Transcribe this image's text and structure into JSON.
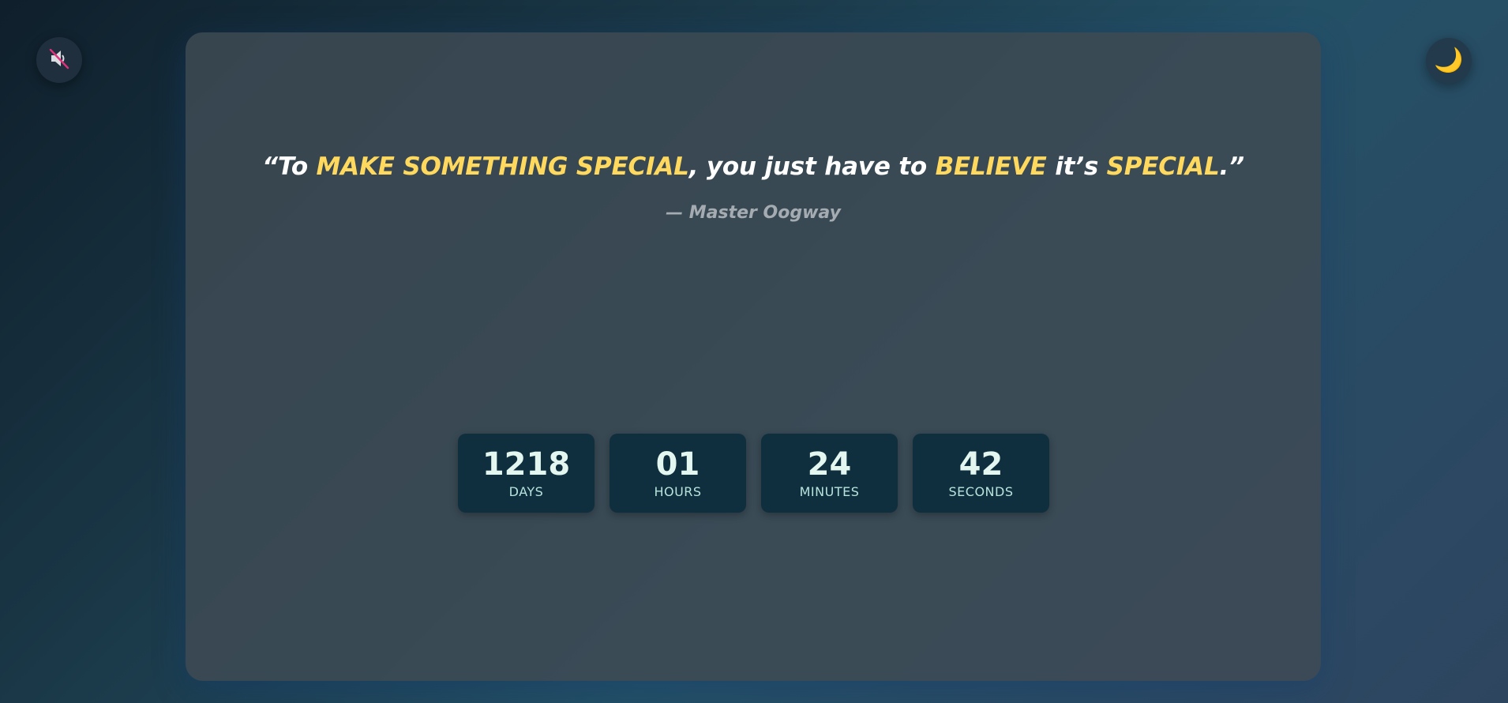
{
  "controls": {
    "mute_icon": "speaker-muted-icon",
    "theme_icon": "moon-icon",
    "theme_glyph": "🌙"
  },
  "quote": {
    "open": "“To ",
    "hl1": "MAKE SOMETHING SPECIAL",
    "mid1": ", you just have to ",
    "hl2": "BELIEVE",
    "mid2": " it’s ",
    "hl3": "SPECIAL",
    "close": ".”",
    "author": "— Master Oogway"
  },
  "countdown": {
    "days": "1218",
    "days_label": "DAYS",
    "hours": "01",
    "hours_label": "HOURS",
    "minutes": "24",
    "minutes_label": "MINUTES",
    "seconds": "42",
    "seconds_label": "SECONDS"
  },
  "colors": {
    "highlight": "#ffd95e",
    "tile_bg": "#0f2f3e",
    "mute_slash": "#e0307a"
  }
}
